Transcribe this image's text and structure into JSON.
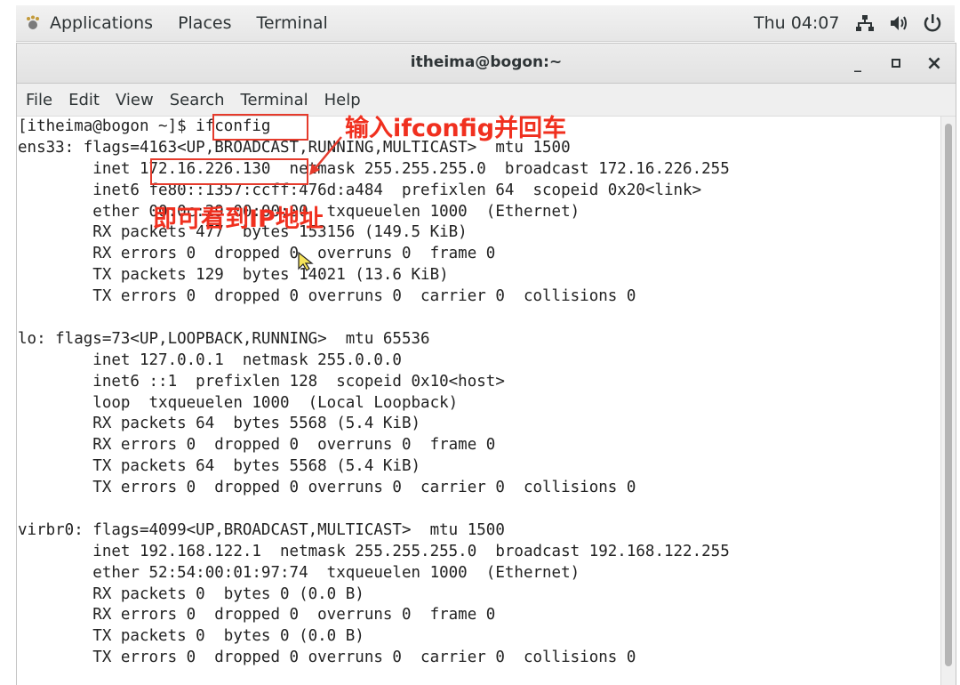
{
  "top_panel": {
    "applications": "Applications",
    "places": "Places",
    "terminal": "Terminal",
    "clock": "Thu 04:07",
    "icons": [
      "network-icon",
      "volume-icon",
      "power-icon"
    ]
  },
  "window": {
    "title": "itheima@bogon:~",
    "minimize": "_",
    "maximize": "▫",
    "close": "×"
  },
  "menu": {
    "file": "File",
    "edit": "Edit",
    "view": "View",
    "search": "Search",
    "terminal": "Terminal",
    "help": "Help"
  },
  "terminal_lines": [
    "[itheima@bogon ~]$ ifconfig",
    "ens33: flags=4163<UP,BROADCAST,RUNNING,MULTICAST>  mtu 1500",
    "        inet 172.16.226.130  netmask 255.255.255.0  broadcast 172.16.226.255",
    "        inet6 fe80::1357:ccff:476d:a484  prefixlen 64  scopeid 0x20<link>",
    "        ether 00:0c:29:00:00:00  txqueuelen 1000  (Ethernet)",
    "        RX packets 477  bytes 153156 (149.5 KiB)",
    "        RX errors 0  dropped 0  overruns 0  frame 0",
    "        TX packets 129  bytes 14021 (13.6 KiB)",
    "        TX errors 0  dropped 0 overruns 0  carrier 0  collisions 0",
    "",
    "lo: flags=73<UP,LOOPBACK,RUNNING>  mtu 65536",
    "        inet 127.0.0.1  netmask 255.0.0.0",
    "        inet6 ::1  prefixlen 128  scopeid 0x10<host>",
    "        loop  txqueuelen 1000  (Local Loopback)",
    "        RX packets 64  bytes 5568 (5.4 KiB)",
    "        RX errors 0  dropped 0  overruns 0  frame 0",
    "        TX packets 64  bytes 5568 (5.4 KiB)",
    "        TX errors 0  dropped 0 overruns 0  carrier 0  collisions 0",
    "",
    "virbr0: flags=4099<UP,BROADCAST,MULTICAST>  mtu 1500",
    "        inet 192.168.122.1  netmask 255.255.255.0  broadcast 192.168.122.255",
    "        ether 52:54:00:01:97:74  txqueuelen 1000  (Ethernet)",
    "        RX packets 0  bytes 0 (0.0 B)",
    "        RX errors 0  dropped 0  overruns 0  frame 0",
    "        TX packets 0  bytes 0 (0.0 B)",
    "        TX errors 0  dropped 0 overruns 0  carrier 0  collisions 0"
  ],
  "annotations": {
    "command_note": "输入ifconfig并回车",
    "ip_note": "即可看到IP地址"
  },
  "colors": {
    "annotation": "#e53b2c"
  }
}
